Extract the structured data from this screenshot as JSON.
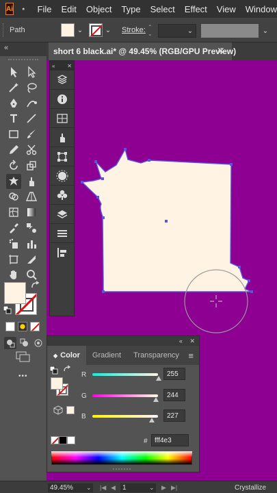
{
  "app": {
    "logo_text": "Ai"
  },
  "menu": [
    "File",
    "Edit",
    "Object",
    "Type",
    "Select",
    "Effect",
    "View",
    "Window"
  ],
  "control_bar": {
    "selection_label": "Path",
    "stroke_label": "Stroke:",
    "fill_color": "#fff4e3"
  },
  "document": {
    "tab_title": "short 6 black.ai* @ 49.45% (RGB/GPU Preview)",
    "close_label": "✕",
    "canvas_color": "#8d0092",
    "shape_fill": "#fff4e3"
  },
  "panels_collapse": "«",
  "color_panel": {
    "tabs": [
      "Color",
      "Gradient",
      "Transparency"
    ],
    "active_tab": "Color",
    "channels": [
      {
        "label": "R",
        "value": "255",
        "level": 1.0
      },
      {
        "label": "G",
        "value": "244",
        "level": 0.957
      },
      {
        "label": "B",
        "value": "227",
        "level": 0.89
      }
    ],
    "hex_prefix": "#",
    "hex_value": "fff4e3",
    "menu_icon": "≡"
  },
  "status_bar": {
    "zoom": "49.45%",
    "page": "1",
    "status_text": "Crystallize"
  },
  "toolbar": {
    "fill_color": "#fff4e3",
    "icons": [
      "selection-tool",
      "direct-selection-tool",
      "magic-wand-tool",
      "lasso-tool",
      "pen-tool",
      "curvature-tool",
      "type-tool",
      "line-tool",
      "rectangle-tool",
      "paintbrush-tool",
      "pencil-tool",
      "scissors-tool",
      "rotate-tool",
      "scale-tool",
      "crystallize-tool",
      "puppet-warp-tool",
      "shape-builder-tool",
      "perspective-tool",
      "mesh-tool",
      "gradient-tool",
      "eyedropper-tool",
      "blend-tool",
      "symbol-sprayer-tool",
      "column-graph-tool",
      "artboard-tool",
      "slice-tool",
      "hand-tool",
      "zoom-tool"
    ],
    "more_label": "•••"
  },
  "icon_panel": [
    "libraries-icon",
    "info-icon",
    "properties-icon",
    "puppet-icon",
    "transform-icon",
    "brushes-icon",
    "symbols-icon",
    "layers-icon",
    "align-icon",
    "artboards-icon"
  ]
}
